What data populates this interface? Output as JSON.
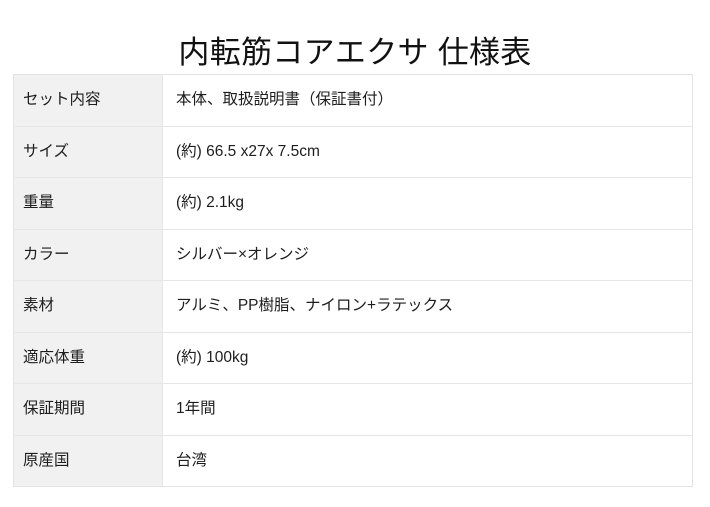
{
  "document": {
    "title": "内転筋コアエクサ 仕様表",
    "background_color": "#ffffff",
    "label_cell_color": "#f1f1f1",
    "value_cell_color": "#ffffff",
    "border_color": "#e6e6e6",
    "text_color": "#1d1d1d"
  },
  "spec_table": {
    "rows": [
      {
        "label": "セット内容",
        "value": "本体、取扱説明書（保証書付）"
      },
      {
        "label": "サイズ",
        "value": "(約) 66.5 x27x 7.5cm"
      },
      {
        "label": "重量",
        "value": "(約) 2.1kg"
      },
      {
        "label": "カラー",
        "value": "シルバー×オレンジ"
      },
      {
        "label": "素材",
        "value": "アルミ、PP樹脂、ナイロン+ラテックス"
      },
      {
        "label": "適応体重",
        "value": "(約) 100kg"
      },
      {
        "label": "保証期間",
        "value": "1年間"
      },
      {
        "label": "原産国",
        "value": "台湾"
      }
    ]
  }
}
